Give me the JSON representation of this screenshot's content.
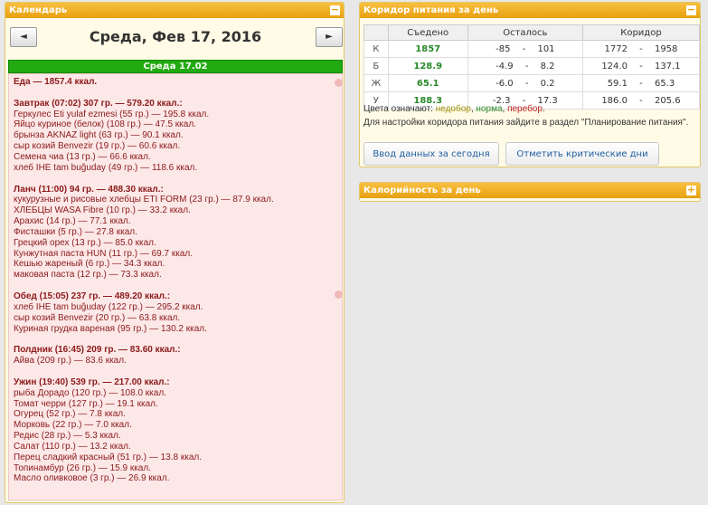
{
  "calendar": {
    "title": "Календарь",
    "toggle": "−",
    "prev": "◄",
    "next": "►",
    "date": "Среда, Фев 17, 2016",
    "day_bar": "Среда 17.02"
  },
  "food_lines": [
    {
      "text": "Еда — 1857.4 ккал.",
      "bold": true
    },
    {
      "text": "",
      "bold": false
    },
    {
      "text": "Завтрак (07:02) 307 гр. — 579.20 ккал.:",
      "bold": true
    },
    {
      "text": "Геркулес Eti yulaf ezmesi (55 гр.) — 195.8 ккал.",
      "bold": false
    },
    {
      "text": "Яйцо куриное (белок) (108 гр.) — 47.5 ккал.",
      "bold": false
    },
    {
      "text": "брынза AKNAZ light (63 гр.) — 90.1 ккал.",
      "bold": false
    },
    {
      "text": "сыр козий Benvezir (19 гр.) — 60.6 ккал.",
      "bold": false
    },
    {
      "text": "Семена чиа (13 гр.) — 66.6 ккал.",
      "bold": false
    },
    {
      "text": "хлеб IHE tam buğuday (49 гр.) — 118.6 ккал.",
      "bold": false
    },
    {
      "text": "",
      "bold": false
    },
    {
      "text": "Ланч (11:00) 94 гр. — 488.30 ккал.:",
      "bold": true
    },
    {
      "text": "кукурузные и рисовые хлебцы ETI FORM (23 гр.) — 87.9 ккал.",
      "bold": false
    },
    {
      "text": "ХЛЕБЦЫ WASA Fibre (10 гр.) — 33.2 ккал.",
      "bold": false
    },
    {
      "text": "Арахис (14 гр.) — 77.1 ккал.",
      "bold": false
    },
    {
      "text": "Фисташки (5 гр.) — 27.8 ккал.",
      "bold": false
    },
    {
      "text": "Грецкий орех (13 гр.) — 85.0 ккал.",
      "bold": false
    },
    {
      "text": "Кунжутная паста HUN (11 гр.) — 69.7 ккал.",
      "bold": false
    },
    {
      "text": "Кешью жареный (6 гр.) — 34.3 ккал.",
      "bold": false
    },
    {
      "text": "маковая паста (12 гр.) — 73.3 ккал.",
      "bold": false
    },
    {
      "text": "",
      "bold": false
    },
    {
      "text": "Обед (15:05) 237 гр. — 489.20 ккал.:",
      "bold": true
    },
    {
      "text": "хлеб IHE tam buğuday (122 гр.) — 295.2 ккал.",
      "bold": false
    },
    {
      "text": "сыр козий Benvezir (20 гр.) — 63.8 ккал.",
      "bold": false
    },
    {
      "text": "Куриная грудка вареная (95 гр.) — 130.2 ккал.",
      "bold": false
    },
    {
      "text": "",
      "bold": false
    },
    {
      "text": "Полдник (16:45) 209 гр. — 83.60 ккал.:",
      "bold": true
    },
    {
      "text": "Айва (209 гр.) — 83.6 ккал.",
      "bold": false
    },
    {
      "text": "",
      "bold": false
    },
    {
      "text": "Ужин (19:40) 539 гр. — 217.00 ккал.:",
      "bold": true
    },
    {
      "text": "рыба Дорадо (120 гр.) — 108.0 ккал.",
      "bold": false
    },
    {
      "text": "Томат черри (127 гр.) — 19.1 ккал.",
      "bold": false
    },
    {
      "text": "Огурец (52 гр.) — 7.8 ккал.",
      "bold": false
    },
    {
      "text": "Морковь (22 гр.) — 7.0 ккал.",
      "bold": false
    },
    {
      "text": "Редис (28 гр.) — 5.3 ккал.",
      "bold": false
    },
    {
      "text": "Салат (110 гр.) — 13.2 ккал.",
      "bold": false
    },
    {
      "text": "Перец сладкий красный (51 гр.) — 13.8 ккал.",
      "bold": false
    },
    {
      "text": "Топинамбур (26 гр.) — 15.9 ккал.",
      "bold": false
    },
    {
      "text": "Масло оливковое (3 гр.) — 26.9 ккал.",
      "bold": false
    }
  ],
  "corridor": {
    "title": "Коридор питания за день",
    "toggle": "−",
    "headers": [
      "",
      "Съедено",
      "Осталось",
      "Коридор"
    ],
    "rows": [
      {
        "label": "К",
        "eaten": "1857",
        "rem_min": "-85",
        "rem_max": "101",
        "cor_min": "1772",
        "cor_max": "1958"
      },
      {
        "label": "Б",
        "eaten": "128.9",
        "rem_min": "-4.9",
        "rem_max": "8.2",
        "cor_min": "124.0",
        "cor_max": "137.1"
      },
      {
        "label": "Ж",
        "eaten": "65.1",
        "rem_min": "-6.0",
        "rem_max": "0.2",
        "cor_min": "59.1",
        "cor_max": "65.3"
      },
      {
        "label": "У",
        "eaten": "188.3",
        "rem_min": "-2.3",
        "rem_max": "17.3",
        "cor_min": "186.0",
        "cor_max": "205.6"
      }
    ],
    "dash": "-",
    "legend_prefix": "Цвета означают: ",
    "legend_under": "недобор",
    "legend_comma1": ", ",
    "legend_norm": "норма",
    "legend_comma2": ", ",
    "legend_over": "перебор",
    "legend_end": ".",
    "info": "Для настройки коридора питания зайдите в раздел \"Планирование питания\".",
    "btn_input": "Ввод данных за сегодня",
    "btn_crit": "Отметить критические дни",
    "colors": {
      "under": "#a09000",
      "norm": "#2a8a2a",
      "over": "#c02020"
    }
  },
  "calories": {
    "title": "Калорийность за день",
    "toggle": "+"
  }
}
